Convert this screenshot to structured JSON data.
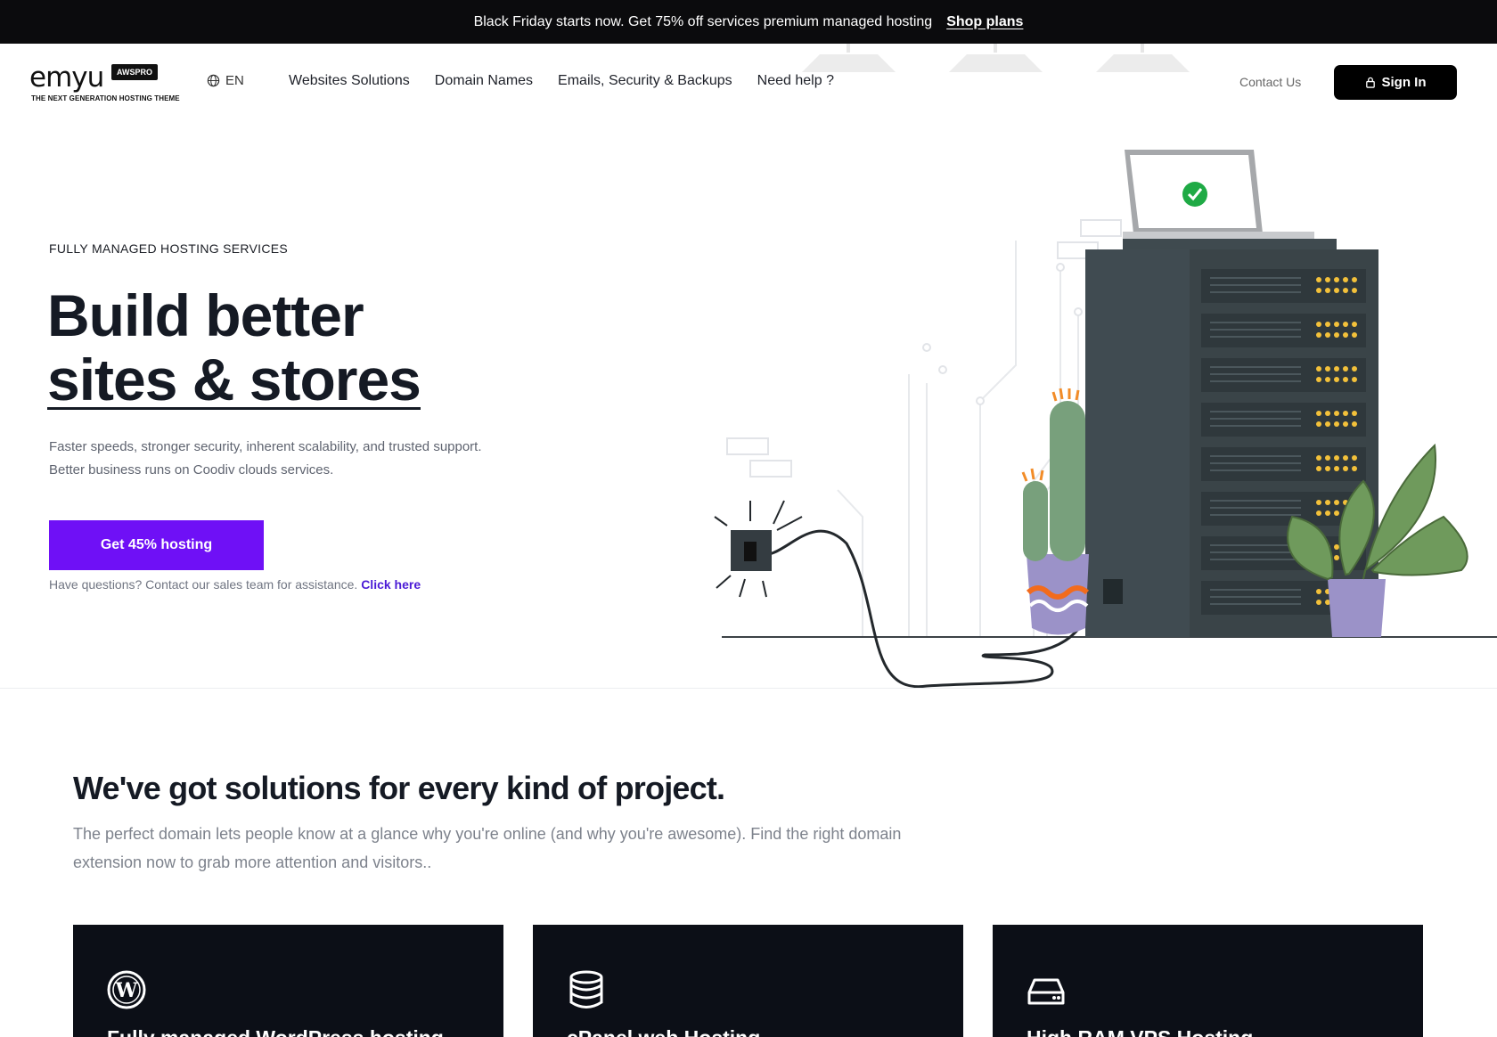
{
  "promo": {
    "text": "Black Friday starts now. Get 75% off services premium managed hosting",
    "link": "Shop plans"
  },
  "header": {
    "logo_word": "emyu",
    "logo_badge": "AWSPRO",
    "logo_tagline": "THE NEXT GENERATION HOSTING THEME",
    "language": "EN",
    "nav": [
      "Websites Solutions",
      "Domain Names",
      "Emails, Security & Backups",
      "Need help ?"
    ],
    "contact": "Contact Us",
    "signin": "Sign In"
  },
  "hero": {
    "eyebrow": "FULLY MANAGED HOSTING SERVICES",
    "title_line1": "Build better",
    "title_line2": "sites & stores",
    "description": "Faster speeds, stronger security, inherent scalability, and trusted support. Better business runs on Coodiv clouds services.",
    "cta": "Get 45% hosting",
    "help_text": "Have questions? Contact our sales team for assistance.",
    "help_link": "Click here"
  },
  "solutions": {
    "title": "We've got solutions for every kind of project.",
    "description": "The perfect domain lets people know at a glance why you're online (and why you're awesome). Find the right domain extension now to grab more attention and visitors..",
    "cards": [
      {
        "icon": "wordpress-icon",
        "title": "Fully managed WordPress hosting"
      },
      {
        "icon": "database-icon",
        "title": "cPanel web Hosting"
      },
      {
        "icon": "server-icon",
        "title": "High RAM VPS Hosting"
      }
    ]
  },
  "colors": {
    "accent": "#6f10f6",
    "dark": "#0c0f17",
    "link": "#4b1bd6"
  }
}
